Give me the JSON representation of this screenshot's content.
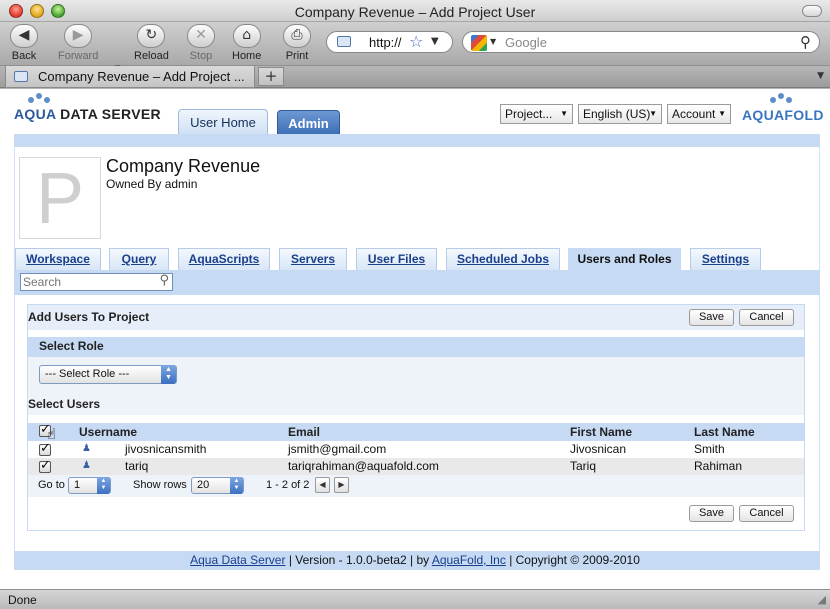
{
  "window": {
    "title": "Company Revenue – Add Project User"
  },
  "toolbar": {
    "back": "Back",
    "forward": "Forward",
    "reload": "Reload",
    "stop": "Stop",
    "home": "Home",
    "print": "Print",
    "url": "http://",
    "search_placeholder": "Google"
  },
  "browser_tab": {
    "label": "Company Revenue – Add Project ..."
  },
  "header": {
    "logo_left_aqua": "AQUA",
    "logo_left_rest": " DATA SERVER",
    "logo_right_aqua": "AQUA",
    "logo_right_fold": "FOLD",
    "tab_home": "User Home",
    "tab_admin": "Admin",
    "project_select": "Project...",
    "language_select": "English (US)",
    "account_select": "Account"
  },
  "project": {
    "initial": "P",
    "name": "Company Revenue",
    "owner": "Owned By admin"
  },
  "project_tabs": [
    "Workspace",
    "Query",
    "AquaScripts",
    "Servers",
    "User Files",
    "Scheduled Jobs",
    "Users and Roles",
    "Settings"
  ],
  "search": {
    "placeholder": "Search"
  },
  "panel": {
    "title": "Add Users To Project",
    "save": "Save",
    "cancel": "Cancel",
    "select_role_label": "Select Role",
    "role_select_value": "--- Select Role ---",
    "select_users_label": "Select Users"
  },
  "grid": {
    "columns": [
      "Username",
      "Email",
      "First Name",
      "Last Name"
    ],
    "rows": [
      {
        "username": "jivosnicansmith",
        "email": "jsmith@gmail.com",
        "first": "Jivosnican",
        "last": "Smith"
      },
      {
        "username": "tariq",
        "email": "tariqrahiman@aquafold.com",
        "first": "Tariq",
        "last": "Rahiman"
      }
    ]
  },
  "pager": {
    "goto_label": "Go to",
    "goto_value": "1",
    "rows_label": "Show rows",
    "rows_value": "20",
    "range": "1 - 2 of 2"
  },
  "footer": {
    "link1": "Aqua Data Server",
    "version": " | Version - 1.0.0-beta2 | by ",
    "link2": "AquaFold, Inc",
    "copyright": " | Copyright © 2009-2010"
  },
  "status": {
    "text": "Done"
  }
}
